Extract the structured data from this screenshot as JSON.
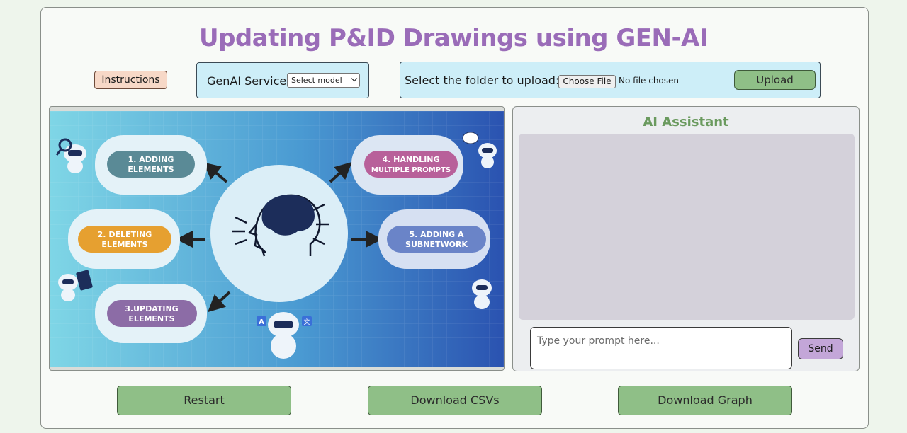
{
  "page": {
    "title": "Updating P&ID Drawings using GEN-AI"
  },
  "toolbar": {
    "instructions_label": "Instructions",
    "genai_label": "GenAI Service:",
    "model_select_value": "Select model",
    "folder_label": "Select the folder to upload:",
    "choose_file_label": "Choose File",
    "file_status": "No file chosen",
    "upload_label": "Upload"
  },
  "diagram": {
    "steps": [
      {
        "label_line1": "1. ADDING",
        "label_line2": "ELEMENTS",
        "color": "#5a8a96"
      },
      {
        "label_line1": "2. DELETING",
        "label_line2": "ELEMENTS",
        "color": "#e6a030"
      },
      {
        "label_line1": "3.UPDATING",
        "label_line2": "ELEMENTS",
        "color": "#8c6ca6"
      },
      {
        "label_line1": "4. HANDLING",
        "label_line2": "MULTIPLE PROMPTS",
        "color": "#b8609a"
      },
      {
        "label_line1": "5. ADDING A",
        "label_line2": "SUBNETWORK",
        "color": "#6a84c8"
      }
    ],
    "badge_left": "A",
    "badge_right": "文"
  },
  "assistant": {
    "title": "AI Assistant",
    "prompt_placeholder": "Type your prompt here...",
    "send_label": "Send"
  },
  "actions": {
    "restart_label": "Restart",
    "download_csvs_label": "Download CSVs",
    "download_graph_label": "Download Graph"
  },
  "colors": {
    "title": "#9a6cb8",
    "green_button": "#8fbf87",
    "panel_blue": "#cdeef8",
    "send_purple": "#c3a6d8"
  }
}
